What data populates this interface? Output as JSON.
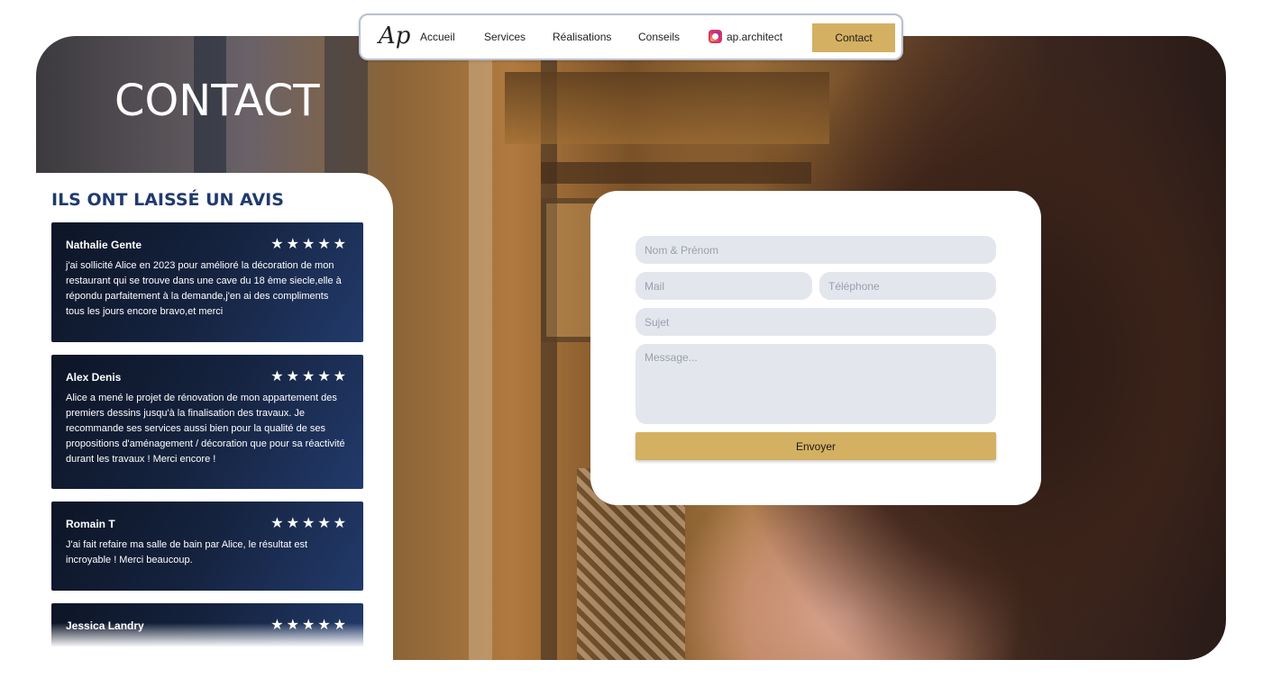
{
  "nav": {
    "logo": "Ap",
    "items": [
      "Accueil",
      "Services",
      "Réalisations",
      "Conseils"
    ],
    "instagram_handle": "ap.architect",
    "contact_label": "Contact"
  },
  "hero": {
    "title": "CONTACT"
  },
  "reviews": {
    "title": "ILS ONT LAISSÉ UN AVIS",
    "stars": "★★★★★",
    "items": [
      {
        "name": "Nathalie Gente",
        "rating": 5,
        "text": "j'ai sollicité Alice en 2023 pour amélioré la décoration de mon restaurant qui se trouve dans une cave du 18 ème siecle,elle à répondu parfaitement à la demande,j'en ai des compliments tous les jours encore bravo,et merci"
      },
      {
        "name": "Alex Denis",
        "rating": 5,
        "text": "Alice a mené le projet de rénovation de mon appartement des premiers dessins jusqu'à la finalisation des travaux. Je recommande ses services aussi bien pour la qualité de ses propositions d'aménagement / décoration que pour sa réactivité durant les travaux ! Merci encore !"
      },
      {
        "name": "Romain T",
        "rating": 5,
        "text": "J'ai fait refaire ma salle de bain par Alice, le résultat est incroyable ! Merci beaucoup."
      },
      {
        "name": "Jessica Landry",
        "rating": 5,
        "text": ""
      }
    ]
  },
  "form": {
    "name_placeholder": "Nom & Prénom",
    "mail_placeholder": "Mail",
    "phone_placeholder": "Téléphone",
    "subject_placeholder": "Sujet",
    "message_placeholder": "Message...",
    "submit_label": "Envoyer"
  },
  "colors": {
    "accent": "#d4b062",
    "navy": "#1f3a6e",
    "field_bg": "#e4e6ee"
  }
}
